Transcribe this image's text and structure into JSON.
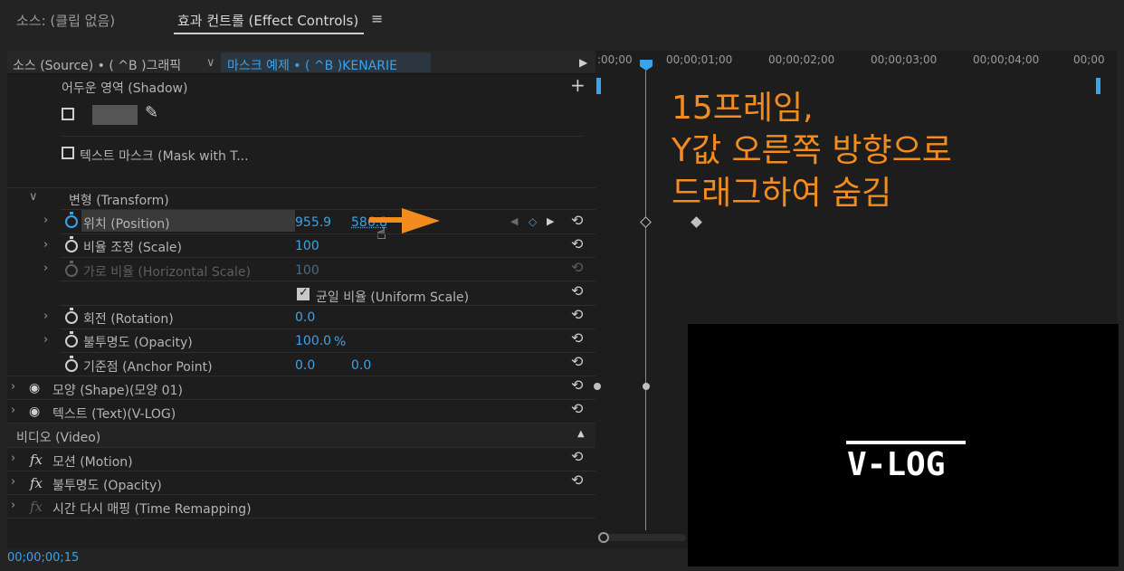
{
  "tabs": {
    "source": "소스: (클립 없음)",
    "effect_controls": "효과 컨트롤 (Effect Controls)",
    "menu_icon": "hamburger-menu-icon"
  },
  "header": {
    "source_clip": "소스 (Source) • ( ^B )그래픽",
    "sequence_clip": "마스크 예제 • ( ^B )KENARIE"
  },
  "ruler": {
    "ticks": [
      ":00;00",
      "00;00;01;00",
      "00;00;02;00",
      "00;00;03;00",
      "00;00;04;00",
      "00;00"
    ]
  },
  "rows": {
    "shadow": "어두운 영역 (Shadow)",
    "mask_text": "텍스트 마스크 (Mask with T...",
    "transform": "변형 (Transform)",
    "position": {
      "label": "위치 (Position)",
      "x": "955.9",
      "y": "586.8"
    },
    "scale": {
      "label": "비율 조정 (Scale)",
      "value": "100"
    },
    "h_scale": {
      "label": "가로 비율 (Horizontal Scale)",
      "value": "100"
    },
    "uniform": "균일 비율 (Uniform Scale)",
    "rotation": {
      "label": "회전 (Rotation)",
      "value": "0.0"
    },
    "opacity": {
      "label": "불투명도 (Opacity)",
      "value": "100.0",
      "unit": "%"
    },
    "anchor": {
      "label": "기준점 (Anchor Point)",
      "x": "0.0",
      "y": "0.0"
    },
    "shape": "모양 (Shape)(모양 01)",
    "text": "텍스트 (Text)(V-LOG)",
    "video_section": "비디오 (Video)",
    "motion": "모션 (Motion)",
    "video_opacity": "불투명도 (Opacity)",
    "time_remap": "시간 다시 매핑 (Time Remapping)"
  },
  "timecode": "00;00;00;15",
  "annotation": "15프레임,\nY값 오른쪽 방향으로\n드래그하여 숨김",
  "preview_title": "V-LOG",
  "colors": {
    "accent_blue": "#3aa3ea",
    "annotation_orange": "#f28c1e"
  }
}
